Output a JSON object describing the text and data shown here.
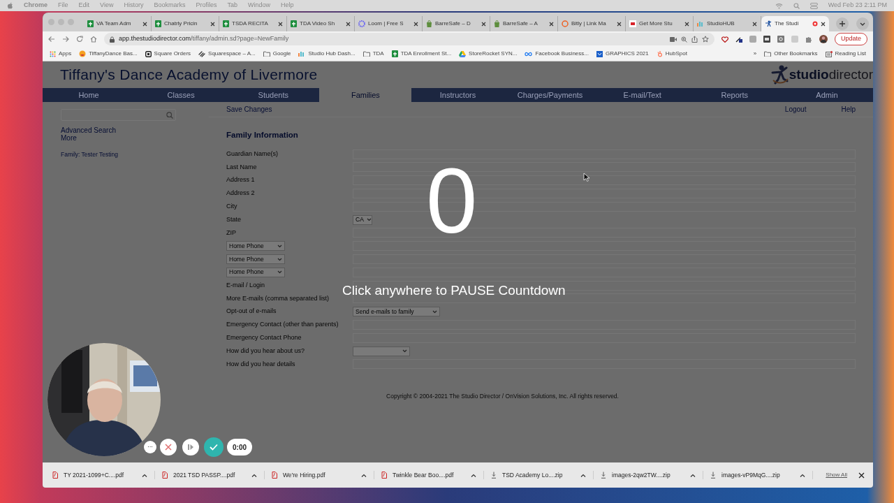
{
  "menu_bar": {
    "app": "Chrome",
    "items": [
      "File",
      "Edit",
      "View",
      "History",
      "Bookmarks",
      "Profiles",
      "Tab",
      "Window",
      "Help"
    ],
    "clock": "Wed Feb 23  2:11 PM"
  },
  "browser": {
    "tabs": [
      {
        "title": "VA Team Adm",
        "kind": "sheet",
        "selected": false
      },
      {
        "title": "Chatrly Pricin",
        "kind": "sheet",
        "selected": false
      },
      {
        "title": "TSDA RECITA",
        "kind": "sheet",
        "selected": false
      },
      {
        "title": "TDA Video Sh",
        "kind": "sheet",
        "selected": false
      },
      {
        "title": "Loom | Free S",
        "kind": "loom",
        "selected": false
      },
      {
        "title": "BarreSafe – D",
        "kind": "shop",
        "selected": false
      },
      {
        "title": "BarreSafe – A",
        "kind": "shop",
        "selected": false
      },
      {
        "title": "Bitly | Link Ma",
        "kind": "bitly",
        "selected": false
      },
      {
        "title": "Get More Stu",
        "kind": "sk",
        "selected": false
      },
      {
        "title": "StudioHUB",
        "kind": "hub",
        "selected": false
      },
      {
        "title": "The Studi",
        "kind": "dancer",
        "selected": true
      }
    ],
    "url_host": "app.thestudiodirector.com",
    "url_path": "/tiffany/admin.sd?page=NewFamily",
    "update_button": "Update",
    "bookmarks": [
      {
        "label": "Apps",
        "kind": "apps"
      },
      {
        "label": "TiffanyDance Bas...",
        "kind": "emoji"
      },
      {
        "label": "Square Orders",
        "kind": "square"
      },
      {
        "label": "Squarespace – A...",
        "kind": "squarespace"
      },
      {
        "label": "Google",
        "kind": "folder"
      },
      {
        "label": "Studio Hub Dash...",
        "kind": "hub"
      },
      {
        "label": "TDA",
        "kind": "folder"
      },
      {
        "label": "TDA Enrollment St...",
        "kind": "sheet"
      },
      {
        "label": "StoreRocket SYN...",
        "kind": "drive"
      },
      {
        "label": "Facebook Business...",
        "kind": "meta"
      },
      {
        "label": "GRAPHICS 2021",
        "kind": "graphics"
      },
      {
        "label": "HubSpot",
        "kind": "hubspot"
      }
    ],
    "overflow": "»",
    "other_bookmarks": "Other Bookmarks",
    "reading_list": "Reading List"
  },
  "page": {
    "title": "Tiffany's Dance Academy of Livermore",
    "logo_a": "studio",
    "logo_b": "director",
    "nav": [
      {
        "label": "Home",
        "selected": false
      },
      {
        "label": "Classes",
        "selected": false
      },
      {
        "label": "Students",
        "selected": false
      },
      {
        "label": "Families",
        "selected": true
      },
      {
        "label": "Instructors",
        "selected": false
      },
      {
        "label": "Charges/Payments",
        "selected": false
      },
      {
        "label": "E-mail/Text",
        "selected": false
      },
      {
        "label": "Reports",
        "selected": false
      },
      {
        "label": "Admin",
        "selected": false
      }
    ],
    "save": "Save Changes",
    "logout": "Logout",
    "help": "Help",
    "sidebar_links": [
      "Advanced Search",
      "More"
    ],
    "family_link": "Family: Tester Testing",
    "section_title": "Family Information",
    "fields": [
      {
        "kind": "text",
        "label": "Guardian Name(s)"
      },
      {
        "kind": "text",
        "label": "Last Name"
      },
      {
        "kind": "text",
        "label": "Address 1"
      },
      {
        "kind": "text",
        "label": "Address 2"
      },
      {
        "kind": "text",
        "label": "City"
      },
      {
        "kind": "select",
        "label": "State",
        "value": "CA"
      },
      {
        "kind": "text",
        "label": "ZIP"
      },
      {
        "kind": "phone",
        "label": "Home Phone"
      },
      {
        "kind": "phone",
        "label": "Home Phone"
      },
      {
        "kind": "phone",
        "label": "Home Phone"
      },
      {
        "kind": "text",
        "label": "E-mail / Login"
      },
      {
        "kind": "text",
        "label": "More E-mails (comma separated list)"
      },
      {
        "kind": "wideselect",
        "label": "Opt-out of e-mails",
        "value": "Send e-mails to family"
      },
      {
        "kind": "text",
        "label": "Emergency Contact (other than parents)"
      },
      {
        "kind": "text",
        "label": "Emergency Contact Phone"
      },
      {
        "kind": "wideselect",
        "label": "How did you hear about us?"
      },
      {
        "kind": "text",
        "label": "How did you hear details"
      }
    ],
    "copyright": "Copyright © 2004-2021 The Studio Director / OnVision Solutions, Inc. All rights reserved."
  },
  "countdown": {
    "number": "0",
    "message": "Click anywhere to PAUSE Countdown"
  },
  "recorder": {
    "more": "···",
    "timer": "0:00"
  },
  "downloads": {
    "items": [
      {
        "name": "TY 2021-1099+C....pdf",
        "kind": "pdf"
      },
      {
        "name": "2021 TSD PASSP....pdf",
        "kind": "pdf"
      },
      {
        "name": "We're Hiring.pdf",
        "kind": "pdf"
      },
      {
        "name": "Twinkle Bear Boo....pdf",
        "kind": "pdf"
      },
      {
        "name": "TSD Academy Lo....zip",
        "kind": "zip"
      },
      {
        "name": "images-2qw2TW....zip",
        "kind": "zip"
      },
      {
        "name": "images-vP9MqG....zip",
        "kind": "zip"
      }
    ],
    "show_all": "Show All"
  }
}
